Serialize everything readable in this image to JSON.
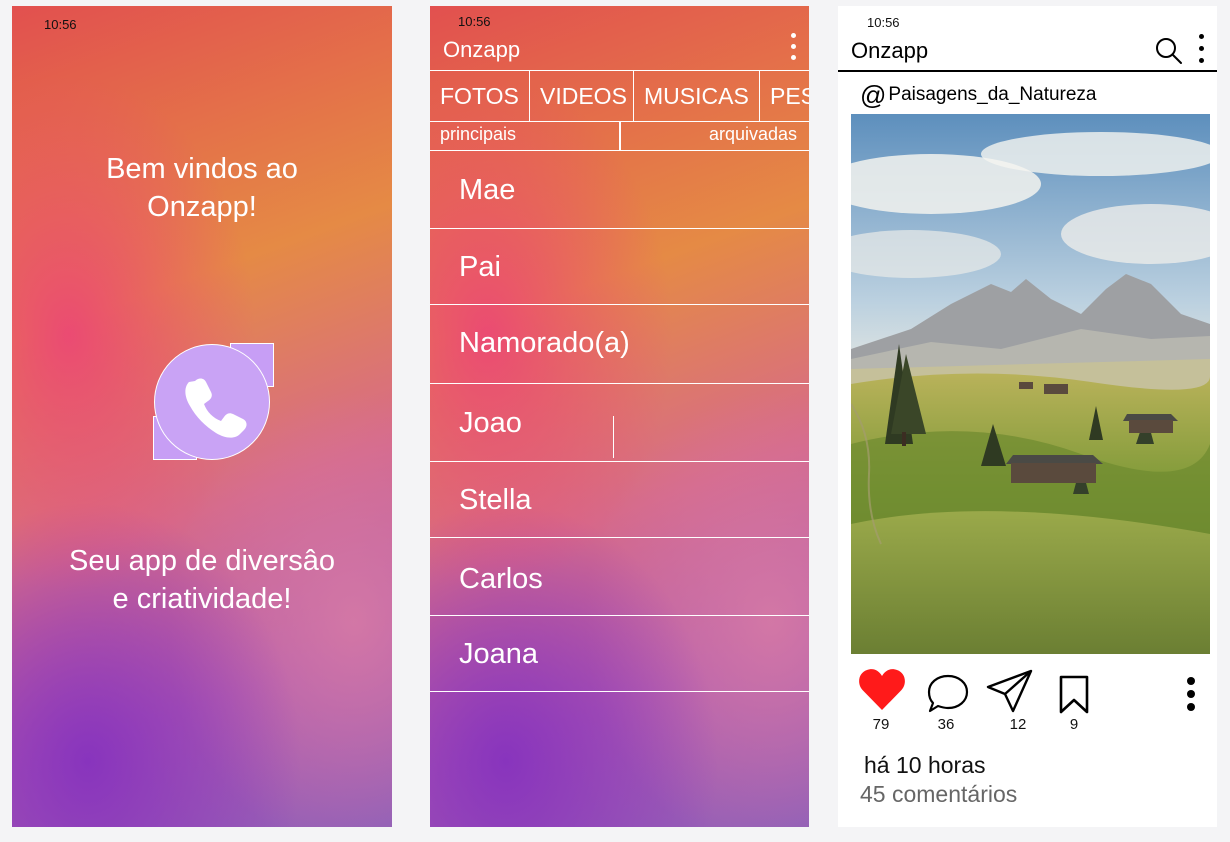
{
  "screens": {
    "welcome": {
      "status_time": "10:56",
      "greeting_line1": "Bem vindos ao",
      "greeting_line2": "Onzapp!",
      "logo_icon": "phone-icon",
      "tagline_line1": "Seu app de diversâo",
      "tagline_line2": "e criatividade!"
    },
    "contacts": {
      "status_time": "10:56",
      "app_title": "Onzapp",
      "menu_icon": "more-vertical-icon",
      "tabs": [
        "FOTOS",
        "VIDEOS",
        "MUSICAS",
        "PES"
      ],
      "subtabs": [
        "principais",
        "arquivadas"
      ],
      "contacts": [
        "Mae",
        "Pai",
        "Namorado(a)",
        "Joao",
        "Stella",
        "Carlos",
        "Joana"
      ]
    },
    "post": {
      "status_time": "10:56",
      "app_title": "Onzapp",
      "search_icon": "search-icon",
      "menu_icon": "more-vertical-icon",
      "handle_prefix": "@",
      "handle": "Paisagens_da_Natureza",
      "likes": "79",
      "comments": "36",
      "shares": "12",
      "saves": "9",
      "time_ago": "há 10 horas",
      "comment_count_label": "45 comentários"
    }
  },
  "colors": {
    "like_red": "#ff1a1a",
    "logo_purple": "#c9a3f5",
    "gradient_top": "#e2504f",
    "gradient_mid": "#e58a45",
    "gradient_bottom": "#8f60b8"
  }
}
